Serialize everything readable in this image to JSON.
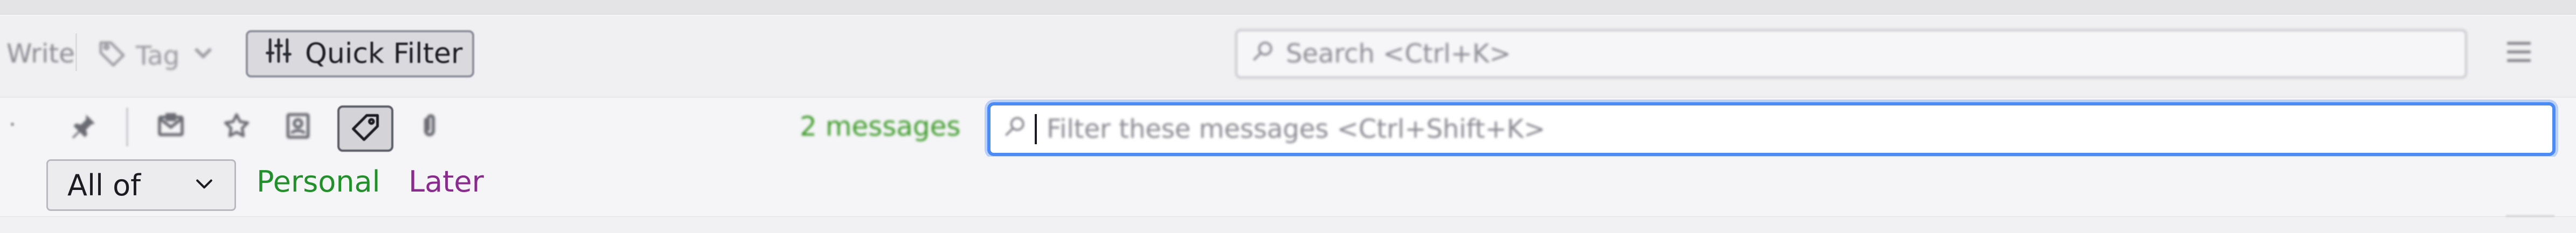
{
  "colors": {
    "accent_focus": "#4c8bf5",
    "message_count": "#3e9b2a",
    "tag_personal": "#22902a",
    "tag_later": "#8a2a8f"
  },
  "toolbar": {
    "left_partial_label": "Write",
    "tag_button": {
      "label": "Tag",
      "icon": "tag-icon"
    },
    "quick_filter_button": {
      "label": "Quick Filter",
      "icon": "sliders-icon"
    },
    "search": {
      "placeholder": "Search <Ctrl+K>",
      "icon": "search-icon"
    },
    "menu_icon": "hamburger-menu-icon"
  },
  "quick_filter_bar": {
    "toggles": [
      {
        "name": "sticky-filter",
        "icon": "pin-icon"
      },
      {
        "name": "unread",
        "icon": "envelope-icon"
      },
      {
        "name": "starred",
        "icon": "star-icon"
      },
      {
        "name": "contact",
        "icon": "contact-card-icon"
      },
      {
        "name": "tags",
        "icon": "tag-icon",
        "pressed": true
      },
      {
        "name": "attachment",
        "icon": "paperclip-icon"
      }
    ],
    "message_count": "2 messages",
    "filter_input": {
      "placeholder": "Filter these messages <Ctrl+Shift+K>",
      "icon": "search-icon"
    }
  },
  "tag_filter": {
    "mode_select": {
      "value": "All of",
      "icon": "chevron-down-icon"
    },
    "tags": [
      {
        "label": "Personal",
        "color": "#22902a"
      },
      {
        "label": "Later",
        "color": "#8a2a8f"
      }
    ]
  }
}
